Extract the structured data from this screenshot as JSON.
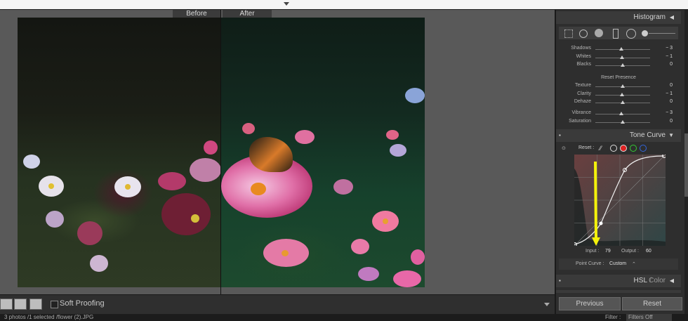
{
  "compare": {
    "before_label": "Before",
    "after_label": "After"
  },
  "toolbar": {
    "soft_proofing_label": "Soft Proofing"
  },
  "filmstrip": {
    "info": "3 photos /1 selected /flower (2).JPG",
    "filter_label": "Filter :",
    "filter_value": "Filters Off"
  },
  "panel": {
    "histogram_title": "Histogram",
    "basic_sliders": [
      {
        "label": "Shadows",
        "value": "− 3",
        "pos": 0.47
      },
      {
        "label": "Whites",
        "value": "− 1",
        "pos": 0.49
      },
      {
        "label": "Blacks",
        "value": "0",
        "pos": 0.5
      }
    ],
    "presence_title": "Reset Presence",
    "presence_sliders": [
      {
        "label": "Texture",
        "value": "0",
        "pos": 0.5
      },
      {
        "label": "Clarity",
        "value": "− 1",
        "pos": 0.49
      },
      {
        "label": "Dehaze",
        "value": "0",
        "pos": 0.5
      }
    ],
    "color_sliders": [
      {
        "label": "Vibrance",
        "value": "− 3",
        "pos": 0.47
      },
      {
        "label": "Saturation",
        "value": "0",
        "pos": 0.5
      }
    ],
    "tone_curve_title": "Tone Curve",
    "tone_curve": {
      "reset_label": "Reset :",
      "input_label": "Input :",
      "input_value": "79",
      "output_label": "Output :",
      "output_value": "60",
      "point_curve_label": "Point Curve :",
      "point_curve_value": "Custom"
    },
    "hsl_title": "HSL",
    "color_title": "Color",
    "previous_button": "Previous",
    "reset_button": "Reset"
  },
  "colors": {
    "accent_arrow": "#f5f20a",
    "panel_bg": "#2e2e2e"
  }
}
